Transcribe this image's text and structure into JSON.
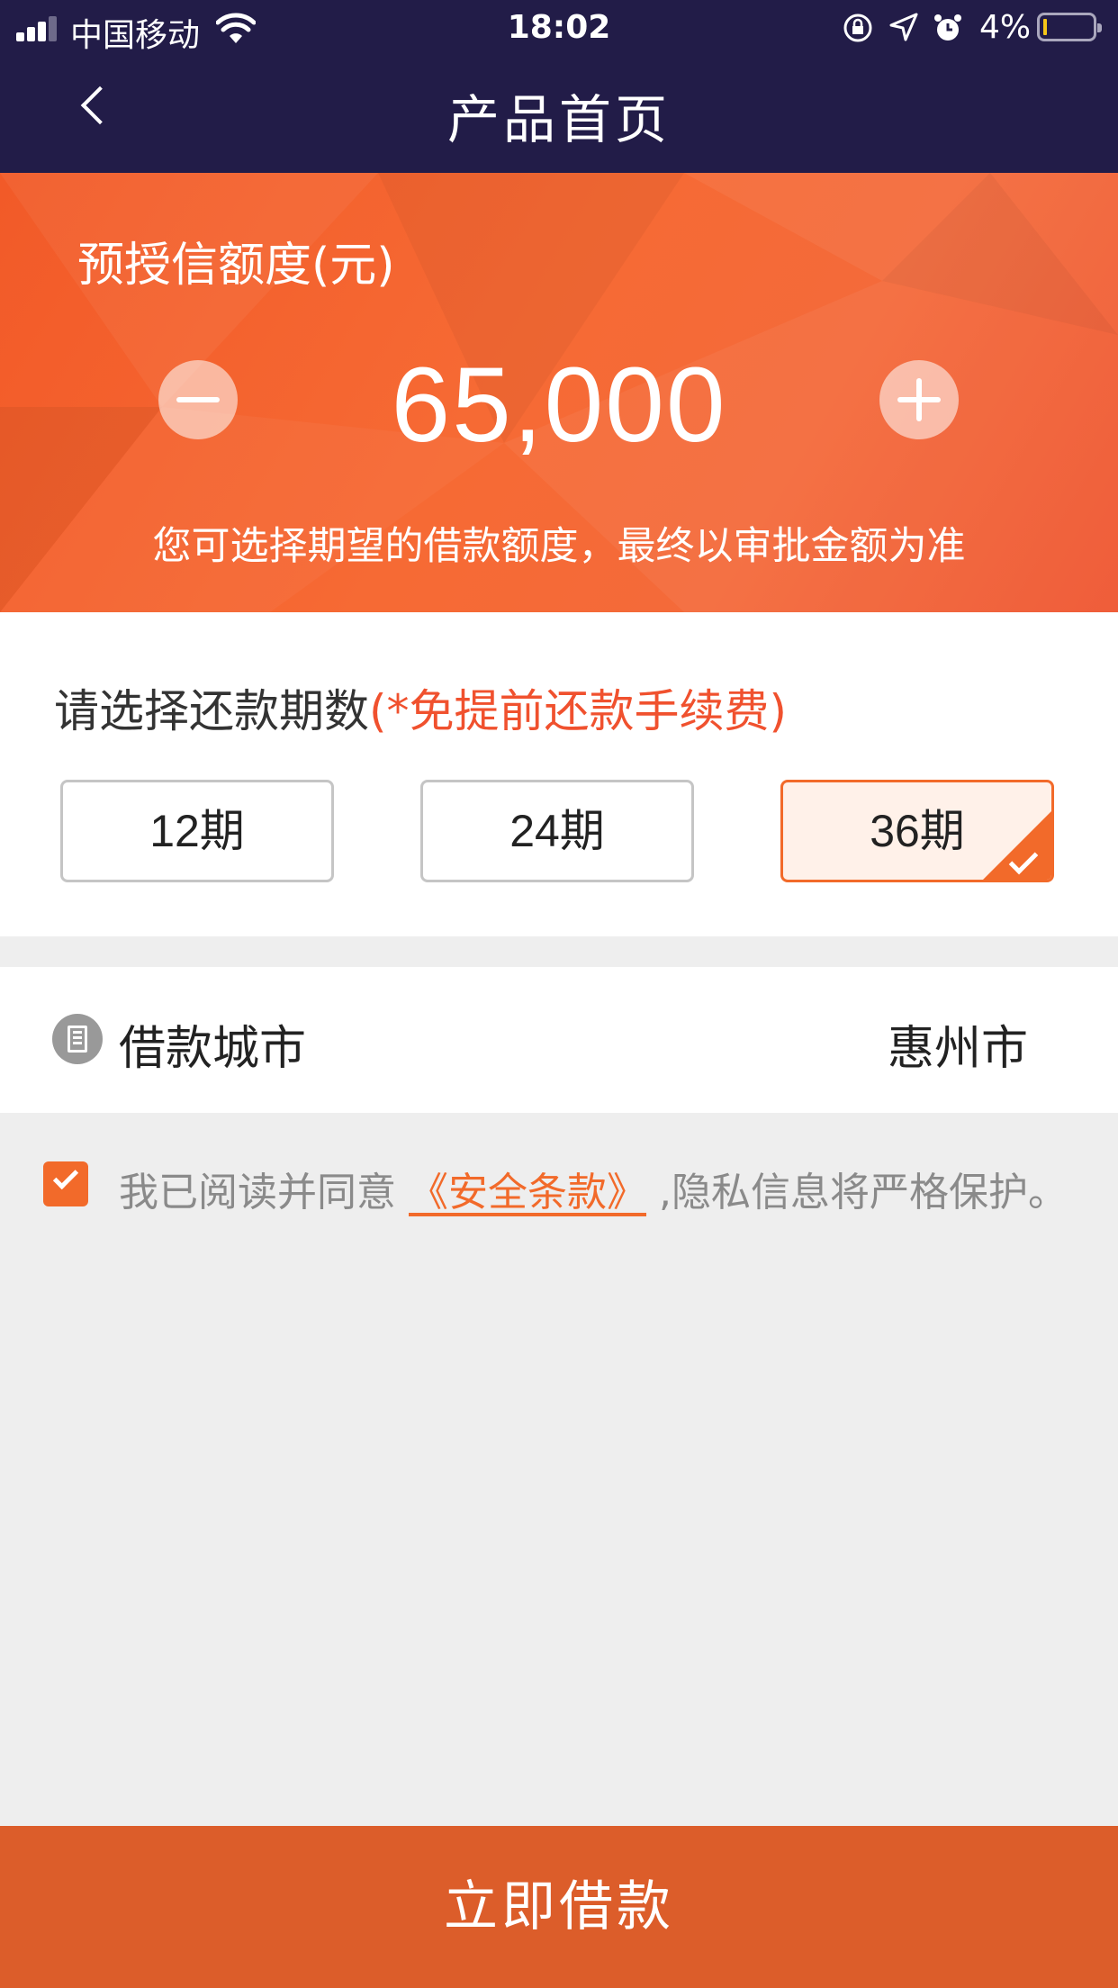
{
  "status_bar": {
    "carrier": "中国移动",
    "time": "18:02",
    "battery_percent": "4%",
    "battery_level": 0.04,
    "icons": [
      "signal-icon",
      "wifi-icon",
      "rotation-lock-icon",
      "location-icon",
      "alarm-icon",
      "battery-icon"
    ]
  },
  "nav": {
    "title": "产品首页",
    "back_icon": "chevron-left-icon"
  },
  "credit": {
    "label": "预授信额度(元)",
    "amount": "65,000",
    "hint": "您可选择期望的借款额度，最终以审批金额为准",
    "decrease_icon": "minus-icon",
    "increase_icon": "plus-icon"
  },
  "repayment": {
    "title": "请选择还款期数",
    "note": "(*免提前还款手续费)",
    "options": [
      {
        "label": "12期",
        "selected": false
      },
      {
        "label": "24期",
        "selected": false
      },
      {
        "label": "36期",
        "selected": true
      }
    ]
  },
  "city": {
    "label": "借款城市",
    "value": "惠州市",
    "icon": "building-icon"
  },
  "agreement": {
    "checked": true,
    "prefix": "我已阅读并同意 ",
    "link": "《安全条款》",
    "suffix": " ,隐私信息将严格保护。"
  },
  "cta": {
    "label": "立即借款"
  },
  "colors": {
    "nav_bg": "#221c48",
    "accent": "#f26a2a",
    "cta_bg": "#dc5d2a",
    "hero_bg": "#f4602f",
    "note_red": "#f0512e"
  }
}
